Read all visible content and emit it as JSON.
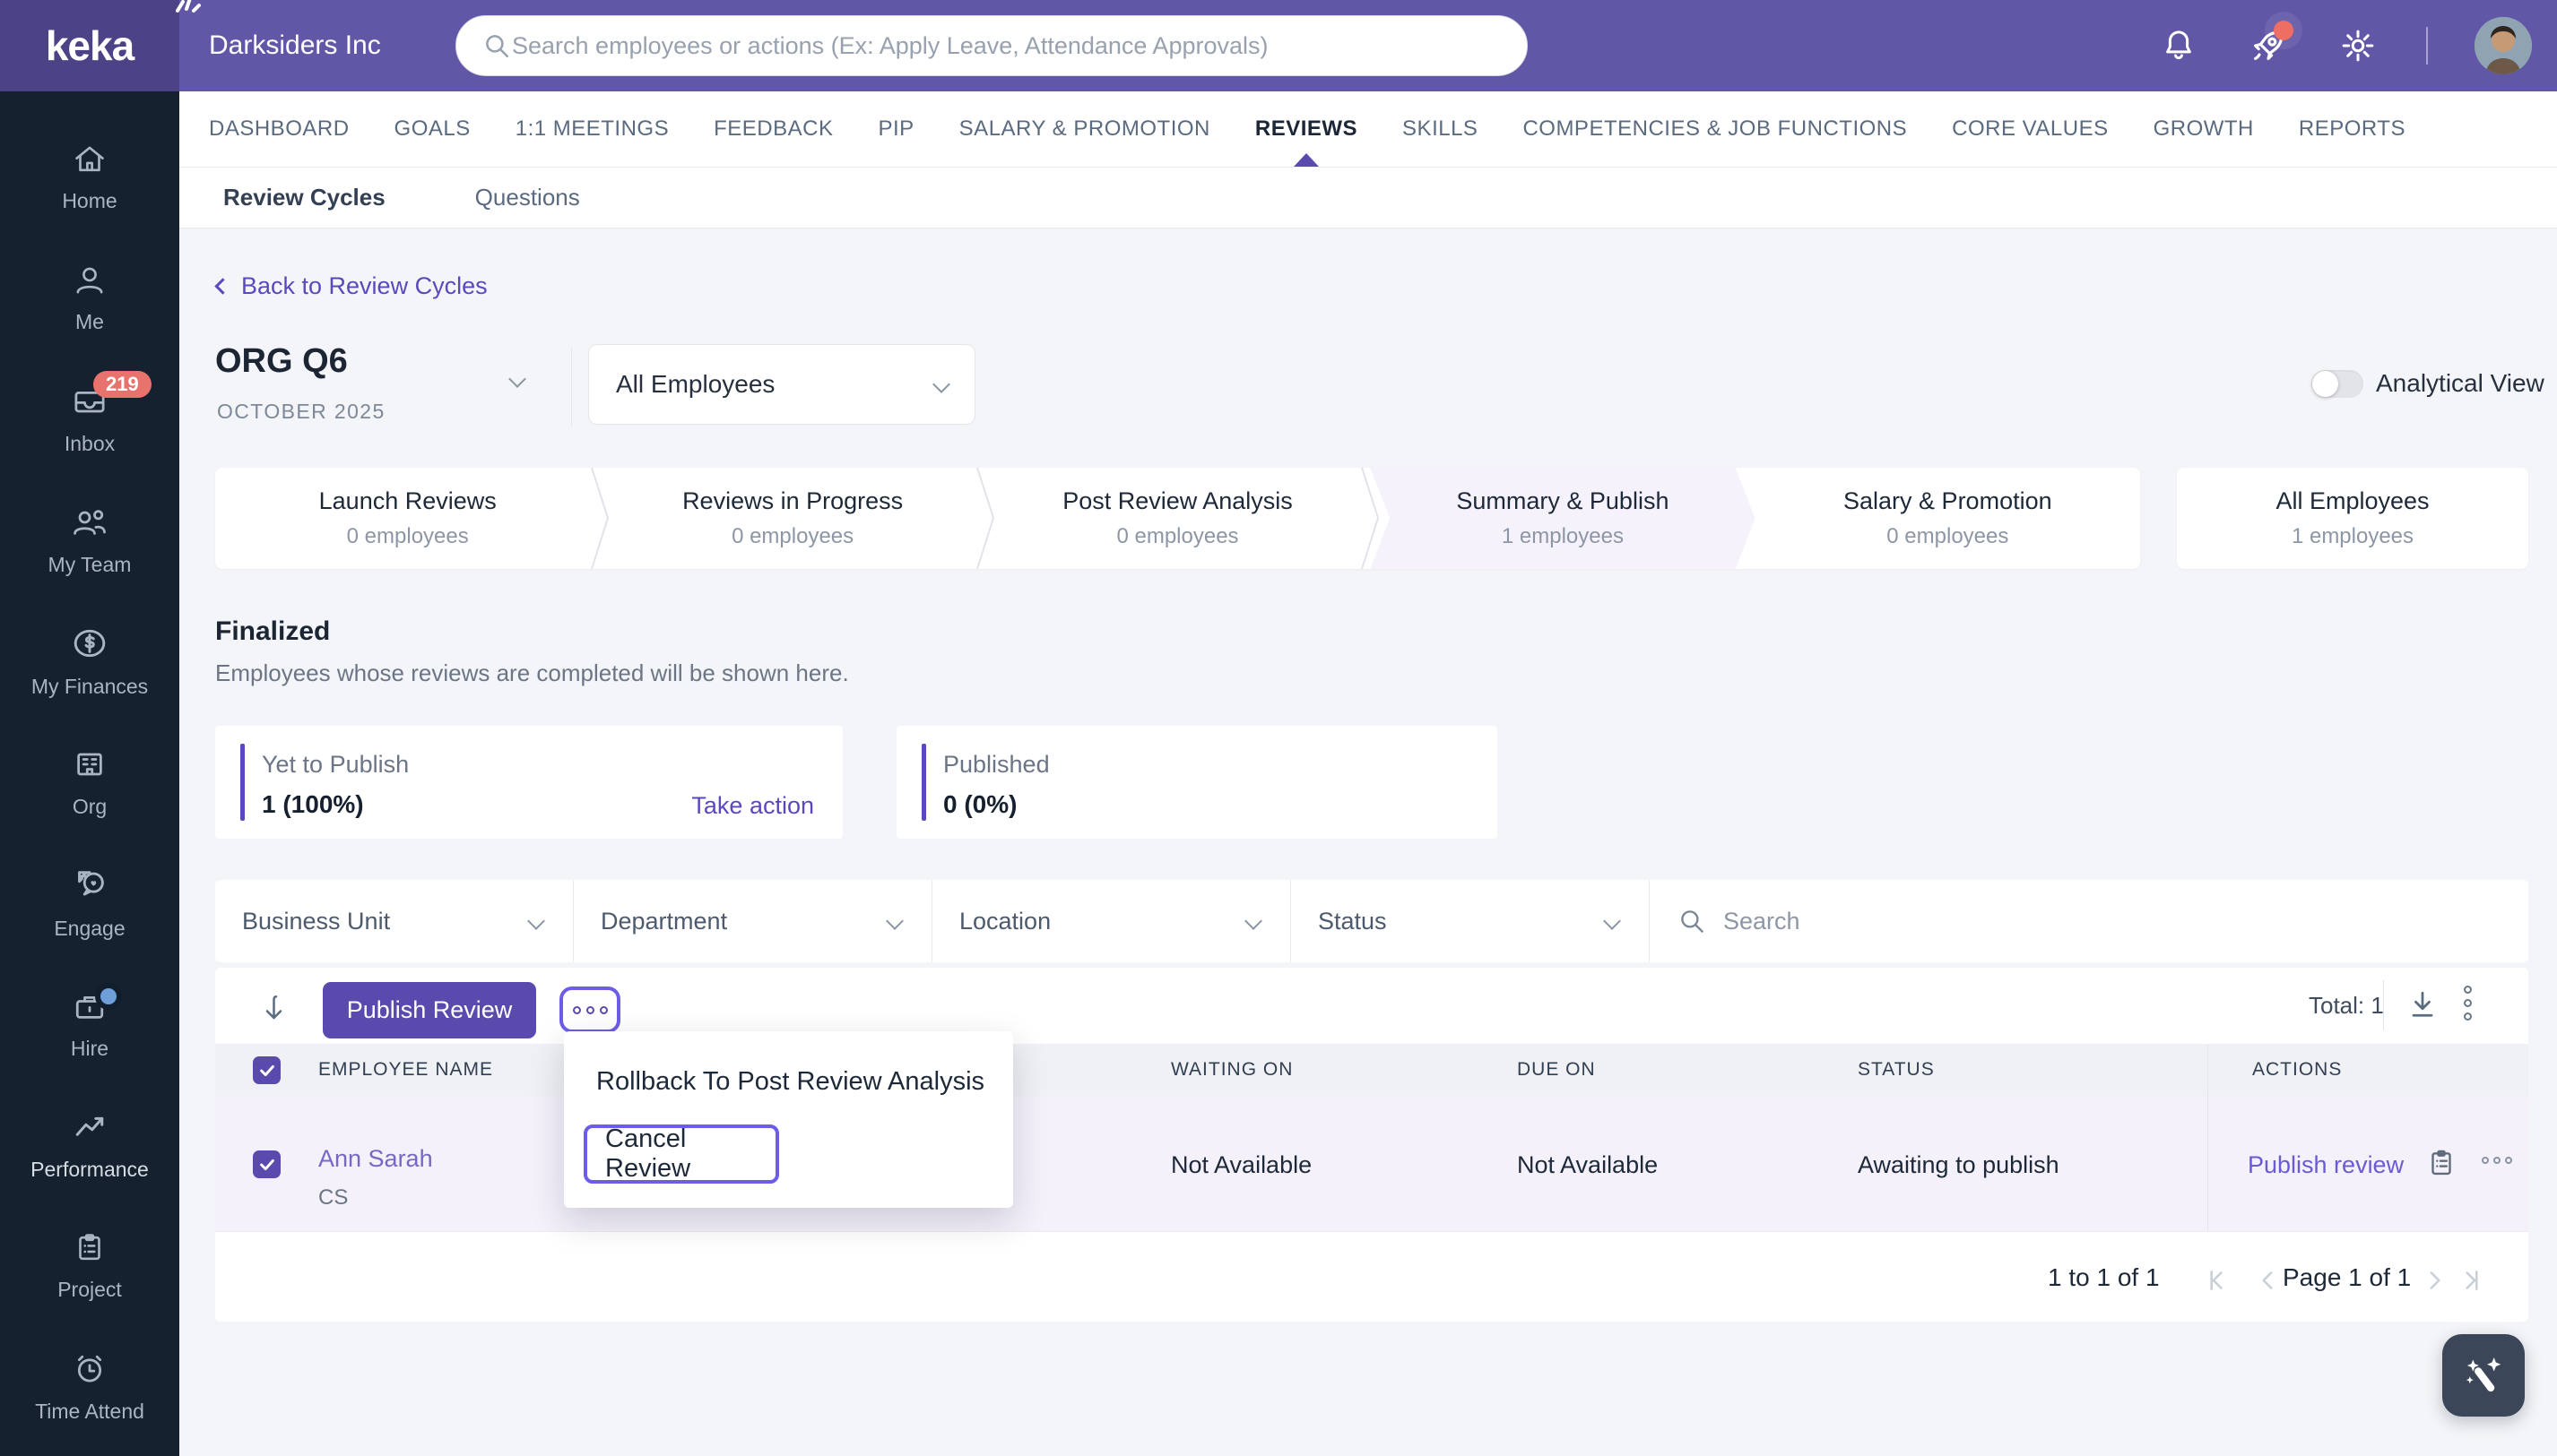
{
  "colors": {
    "topbar": "#6157a7",
    "logo_block": "#4c4286",
    "sidebar": "#16212f",
    "accent_purple": "#5b4aad",
    "accent_bright": "#6c5ce7",
    "link_purple": "#5a49bd",
    "badge_red": "#e8736c",
    "selected_row": "#f4f1fa",
    "highlight_stage": "#f5f2fc"
  },
  "topbar": {
    "logo": "keka",
    "company": "Darksiders Inc",
    "search_placeholder": "Search employees or actions (Ex: Apply Leave, Attendance Approvals)"
  },
  "sidebar": {
    "items": [
      {
        "label": "Home"
      },
      {
        "label": "Me"
      },
      {
        "label": "Inbox",
        "badge": "219"
      },
      {
        "label": "My Team"
      },
      {
        "label": "My Finances"
      },
      {
        "label": "Org"
      },
      {
        "label": "Engage"
      },
      {
        "label": "Hire"
      },
      {
        "label": "Performance"
      },
      {
        "label": "Project"
      },
      {
        "label": "Time Attend"
      }
    ]
  },
  "nav": {
    "tabs": [
      {
        "label": "DASHBOARD"
      },
      {
        "label": "GOALS"
      },
      {
        "label": "1:1 MEETINGS"
      },
      {
        "label": "FEEDBACK"
      },
      {
        "label": "PIP"
      },
      {
        "label": "SALARY & PROMOTION"
      },
      {
        "label": "REVIEWS"
      },
      {
        "label": "SKILLS"
      },
      {
        "label": "COMPETENCIES & JOB FUNCTIONS"
      },
      {
        "label": "CORE VALUES"
      },
      {
        "label": "GROWTH"
      },
      {
        "label": "REPORTS"
      }
    ],
    "active": "REVIEWS"
  },
  "subnav": {
    "items": [
      {
        "label": "Review Cycles"
      },
      {
        "label": "Questions"
      }
    ],
    "active": "Review Cycles"
  },
  "page": {
    "back_link": "Back to Review Cycles",
    "cycle": {
      "name": "ORG Q6",
      "period": "OCTOBER 2025"
    },
    "audience_filter": "All Employees",
    "analytical_view_label": "Analytical View",
    "stages": [
      {
        "name": "Launch Reviews",
        "count": "0 employees"
      },
      {
        "name": "Reviews in Progress",
        "count": "0 employees"
      },
      {
        "name": "Post Review Analysis",
        "count": "0 employees"
      },
      {
        "name": "Summary & Publish",
        "count": "1 employees"
      },
      {
        "name": "Salary & Promotion",
        "count": "0 employees"
      }
    ],
    "all_employees_card": {
      "name": "All Employees",
      "count": "1 employees"
    },
    "finalized": {
      "title": "Finalized",
      "subtitle": "Employees whose reviews are completed will be shown here."
    },
    "summary_cards": [
      {
        "label": "Yet to Publish",
        "value": "1 (100%)",
        "action": "Take action"
      },
      {
        "label": "Published",
        "value": "0 (0%)"
      }
    ],
    "filters": [
      {
        "label": "Business Unit"
      },
      {
        "label": "Department"
      },
      {
        "label": "Location"
      },
      {
        "label": "Status"
      }
    ],
    "filter_search_placeholder": "Search",
    "toolbar": {
      "publish_label": "Publish Review",
      "total": "Total: 1"
    },
    "menu": {
      "item1": "Rollback To Post Review Analysis",
      "item2": "Cancel Review"
    },
    "table": {
      "headers": [
        "EMPLOYEE NAME",
        "WAITING ON",
        "DUE ON",
        "STATUS",
        "ACTIONS"
      ],
      "rows": [
        {
          "name": "Ann Sarah",
          "dept": "CS",
          "waiting_on": "Not Available",
          "due_on": "Not Available",
          "status": "Awaiting to publish",
          "action": "Publish review"
        }
      ]
    },
    "pagination": {
      "range": "1 to 1 of 1",
      "page": "Page 1 of 1"
    }
  }
}
